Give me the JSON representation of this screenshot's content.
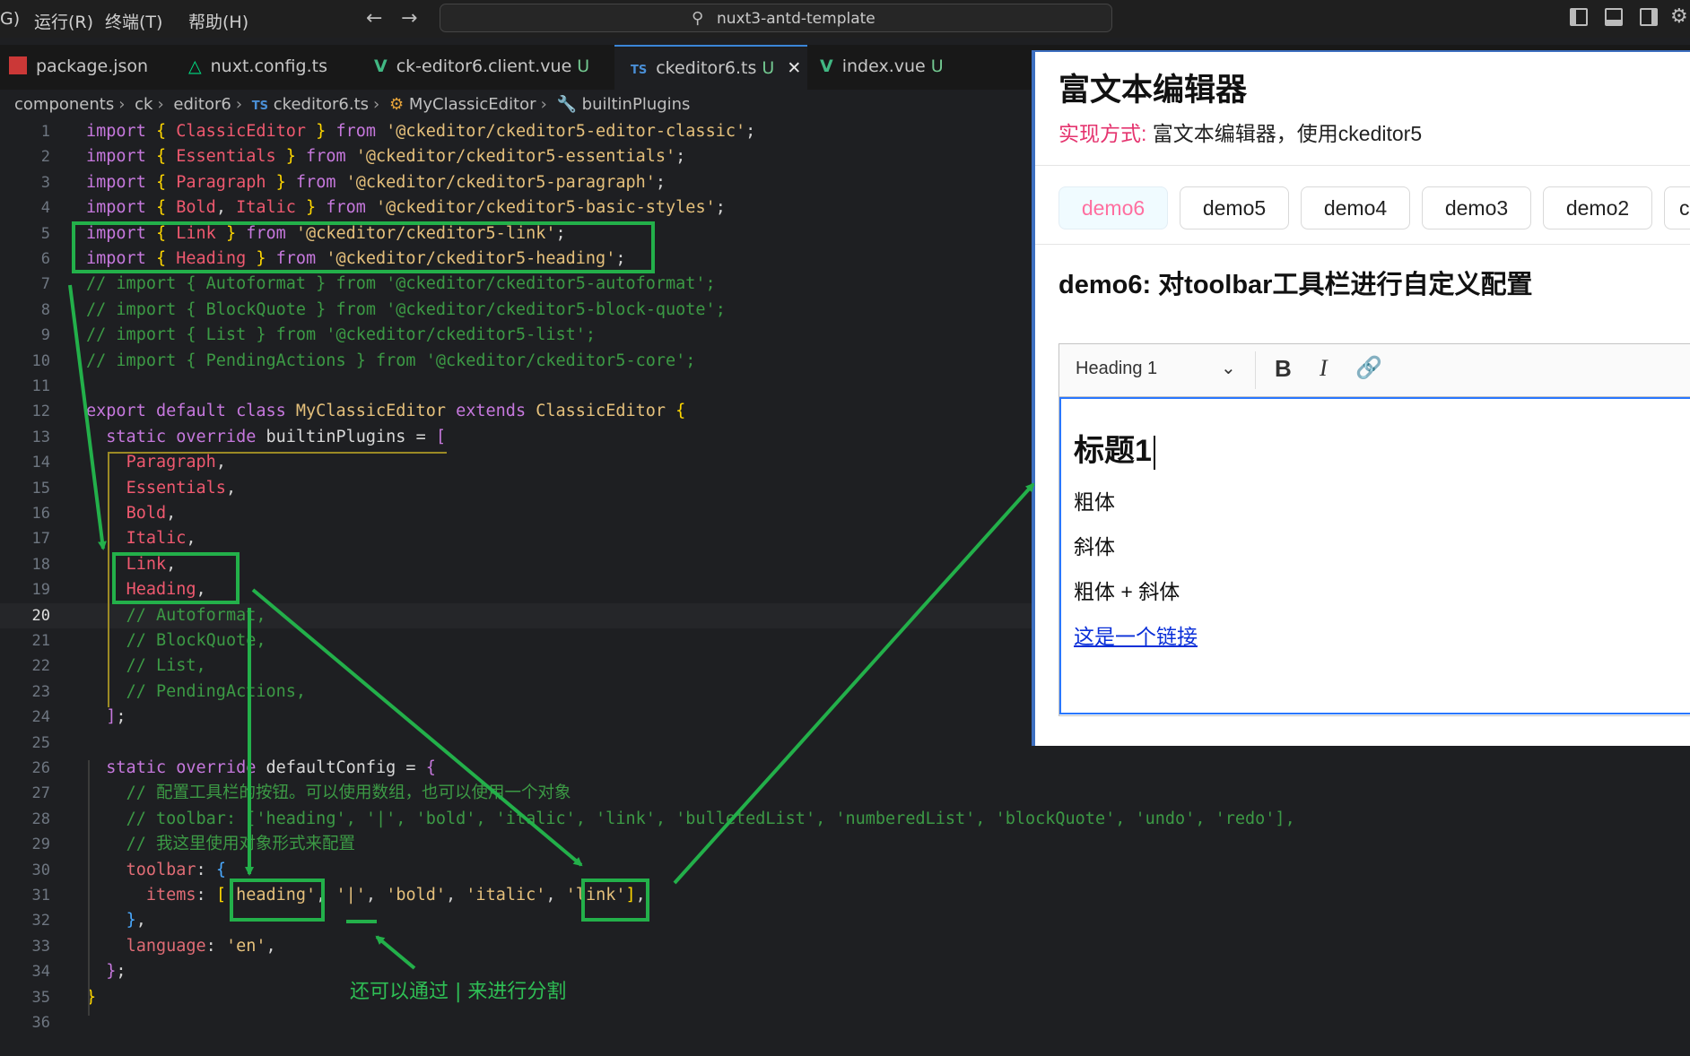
{
  "titlebar": {
    "menu_partial": "G)",
    "menu_run": "运行(R)",
    "menu_terminal": "终端(T)",
    "menu_help": "帮助(H)",
    "search_text": "nuxt3-antd-template"
  },
  "tabs": [
    {
      "label": "package.json",
      "icon": "npm-icon",
      "modified": ""
    },
    {
      "label": "nuxt.config.ts",
      "icon": "nuxt-icon",
      "modified": ""
    },
    {
      "label": "ck-editor6.client.vue",
      "icon": "vue-icon",
      "modified": "U"
    },
    {
      "label": "ckeditor6.ts",
      "icon": "ts-icon",
      "modified": "U"
    },
    {
      "label": "index.vue",
      "icon": "vue-icon",
      "modified": "U"
    }
  ],
  "breadcrumb": {
    "c1": "components",
    "c2": "ck",
    "c3": "editor6",
    "ts_badge": "TS",
    "c4": "ckeditor6.ts",
    "c5": "MyClassicEditor",
    "c6": "builtinPlugins"
  },
  "editor": {
    "current_line": 20,
    "line_numbers": [
      "1",
      "2",
      "3",
      "4",
      "5",
      "6",
      "7",
      "8",
      "9",
      "10",
      "11",
      "12",
      "13",
      "14",
      "15",
      "16",
      "17",
      "18",
      "19",
      "20",
      "21",
      "22",
      "23",
      "24",
      "25",
      "26",
      "27",
      "28",
      "29",
      "30",
      "31",
      "32",
      "33",
      "34",
      "35",
      "36"
    ],
    "lines": [
      [
        [
          "kw",
          "import "
        ],
        [
          "br",
          "{ "
        ],
        [
          "id",
          "ClassicEditor"
        ],
        [
          "br",
          " }"
        ],
        [
          "kw",
          " from "
        ],
        [
          "str",
          "'@ckeditor/ckeditor5-editor-classic'"
        ],
        [
          "plain",
          ";"
        ]
      ],
      [
        [
          "kw",
          "import "
        ],
        [
          "br",
          "{ "
        ],
        [
          "id",
          "Essentials"
        ],
        [
          "br",
          " }"
        ],
        [
          "kw",
          " from "
        ],
        [
          "str",
          "'@ckeditor/ckeditor5-essentials'"
        ],
        [
          "plain",
          ";"
        ]
      ],
      [
        [
          "kw",
          "import "
        ],
        [
          "br",
          "{ "
        ],
        [
          "id",
          "Paragraph"
        ],
        [
          "br",
          " }"
        ],
        [
          "kw",
          " from "
        ],
        [
          "str",
          "'@ckeditor/ckeditor5-paragraph'"
        ],
        [
          "plain",
          ";"
        ]
      ],
      [
        [
          "kw",
          "import "
        ],
        [
          "br",
          "{ "
        ],
        [
          "id",
          "Bold"
        ],
        [
          "plain",
          ", "
        ],
        [
          "id",
          "Italic"
        ],
        [
          "br",
          " }"
        ],
        [
          "kw",
          " from "
        ],
        [
          "str",
          "'@ckeditor/ckeditor5-basic-styles'"
        ],
        [
          "plain",
          ";"
        ]
      ],
      [
        [
          "kw",
          "import "
        ],
        [
          "br",
          "{ "
        ],
        [
          "id",
          "Link"
        ],
        [
          "br",
          " }"
        ],
        [
          "kw",
          " from "
        ],
        [
          "str",
          "'@ckeditor/ckeditor5-link'"
        ],
        [
          "plain",
          ";"
        ]
      ],
      [
        [
          "kw",
          "import "
        ],
        [
          "br",
          "{ "
        ],
        [
          "id",
          "Heading"
        ],
        [
          "br",
          " }"
        ],
        [
          "kw",
          " from "
        ],
        [
          "str",
          "'@ckeditor/ckeditor5-heading'"
        ],
        [
          "plain",
          ";"
        ]
      ],
      [
        [
          "cm",
          "// import { Autoformat } from '@ckeditor/ckeditor5-autoformat';"
        ]
      ],
      [
        [
          "cm",
          "// import { BlockQuote } from '@ckeditor/ckeditor5-block-quote';"
        ]
      ],
      [
        [
          "cm",
          "// import { List } from '@ckeditor/ckeditor5-list';"
        ]
      ],
      [
        [
          "cm",
          "// import { PendingActions } from '@ckeditor/ckeditor5-core';"
        ]
      ],
      [
        [
          "plain",
          ""
        ]
      ],
      [
        [
          "kw",
          "export default class "
        ],
        [
          "cls",
          "MyClassicEditor"
        ],
        [
          "kw",
          " extends "
        ],
        [
          "cls",
          "ClassicEditor"
        ],
        [
          "br",
          " {"
        ]
      ],
      [
        [
          "plain",
          "  "
        ],
        [
          "kw",
          "static override "
        ],
        [
          "fn",
          "builtinPlugins"
        ],
        [
          "plain",
          " = "
        ],
        [
          "kw",
          "["
        ]
      ],
      [
        [
          "plain",
          "    "
        ],
        [
          "id",
          "Paragraph"
        ],
        [
          "plain",
          ","
        ]
      ],
      [
        [
          "plain",
          "    "
        ],
        [
          "id",
          "Essentials"
        ],
        [
          "plain",
          ","
        ]
      ],
      [
        [
          "plain",
          "    "
        ],
        [
          "id",
          "Bold"
        ],
        [
          "plain",
          ","
        ]
      ],
      [
        [
          "plain",
          "    "
        ],
        [
          "id",
          "Italic"
        ],
        [
          "plain",
          ","
        ]
      ],
      [
        [
          "plain",
          "    "
        ],
        [
          "id",
          "Link"
        ],
        [
          "plain",
          ","
        ]
      ],
      [
        [
          "plain",
          "    "
        ],
        [
          "id",
          "Heading"
        ],
        [
          "plain",
          ","
        ]
      ],
      [
        [
          "plain",
          "    "
        ],
        [
          "cm",
          "// Autoformat,"
        ]
      ],
      [
        [
          "plain",
          "    "
        ],
        [
          "cm",
          "// BlockQuote,"
        ]
      ],
      [
        [
          "plain",
          "    "
        ],
        [
          "cm",
          "// List,"
        ]
      ],
      [
        [
          "plain",
          "    "
        ],
        [
          "cm",
          "// PendingActions,"
        ]
      ],
      [
        [
          "plain",
          "  "
        ],
        [
          "kw",
          "]"
        ],
        [
          "plain",
          ";"
        ]
      ],
      [
        [
          "plain",
          ""
        ]
      ],
      [
        [
          "plain",
          "  "
        ],
        [
          "kw",
          "static override "
        ],
        [
          "fn",
          "defaultConfig"
        ],
        [
          "plain",
          " = "
        ],
        [
          "kw",
          "{"
        ]
      ],
      [
        [
          "plain",
          "    "
        ],
        [
          "cm",
          "// 配置工具栏的按钮。可以使用数组，也可以使用一个对象"
        ]
      ],
      [
        [
          "plain",
          "    "
        ],
        [
          "cm",
          "// toolbar: ['heading', '|', 'bold', 'italic', 'link', 'bulletedList', 'numberedList', 'blockQuote', 'undo', 'redo'],"
        ]
      ],
      [
        [
          "plain",
          "    "
        ],
        [
          "cm",
          "// 我这里使用对象形式来配置"
        ]
      ],
      [
        [
          "plain",
          "    "
        ],
        [
          "pink",
          "toolbar"
        ],
        [
          "plain",
          ": "
        ],
        [
          "bl",
          "{"
        ]
      ],
      [
        [
          "plain",
          "      "
        ],
        [
          "pink",
          "items"
        ],
        [
          "plain",
          ": "
        ],
        [
          "br",
          "["
        ],
        [
          "str",
          "'heading'"
        ],
        [
          "plain",
          ", "
        ],
        [
          "str",
          "'|'"
        ],
        [
          "plain",
          ", "
        ],
        [
          "str",
          "'bold'"
        ],
        [
          "plain",
          ", "
        ],
        [
          "str",
          "'italic'"
        ],
        [
          "plain",
          ", "
        ],
        [
          "str",
          "'link'"
        ],
        [
          "br",
          "]"
        ],
        [
          "plain",
          ","
        ]
      ],
      [
        [
          "plain",
          "    "
        ],
        [
          "bl",
          "}"
        ],
        [
          "plain",
          ","
        ]
      ],
      [
        [
          "plain",
          "    "
        ],
        [
          "pink",
          "language"
        ],
        [
          "plain",
          ": "
        ],
        [
          "str",
          "'en'"
        ],
        [
          "plain",
          ","
        ]
      ],
      [
        [
          "plain",
          "  "
        ],
        [
          "kw",
          "}"
        ],
        [
          "plain",
          ";"
        ]
      ],
      [
        [
          "br",
          "}"
        ]
      ],
      [
        [
          "plain",
          ""
        ]
      ]
    ],
    "annotation": "还可以通过 | 来进行分割"
  },
  "preview": {
    "title": "富文本编辑器",
    "subtitle_label": "实现方式:",
    "subtitle_text": "富文本编辑器，使用ckeditor5",
    "demo_tabs": [
      "demo6",
      "demo5",
      "demo4",
      "demo3",
      "demo2",
      "c"
    ],
    "active_demo": "demo6",
    "heading": "demo6: 对toolbar工具栏进行自定义配置",
    "toolbar": {
      "heading_select": "Heading 1",
      "bold": "B",
      "italic": "I"
    },
    "content": {
      "h1": "标题1",
      "p1": "粗体",
      "p2": "斜体",
      "p3": "粗体 + 斜体",
      "link": "这是一个链接"
    }
  },
  "colors": {
    "annotation_green": "#23b04a",
    "accent": "#3a86d8"
  }
}
